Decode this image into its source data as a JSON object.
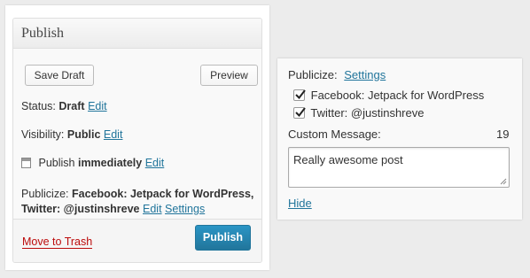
{
  "publish_box": {
    "title": "Publish",
    "save_draft_label": "Save Draft",
    "preview_label": "Preview",
    "status": {
      "label": "Status:",
      "value": "Draft",
      "edit": "Edit"
    },
    "visibility": {
      "label": "Visibility:",
      "value": "Public",
      "edit": "Edit"
    },
    "schedule": {
      "label": "Publish",
      "value": "immediately",
      "edit": "Edit"
    },
    "publicize": {
      "label": "Publicize:",
      "value_line1": "Facebook: Jetpack for WordPress,",
      "value_line2": "Twitter: @justinshreve",
      "edit": "Edit",
      "settings": "Settings"
    },
    "trash_label": "Move to Trash",
    "publish_label": "Publish"
  },
  "publicize_panel": {
    "label": "Publicize:",
    "settings_link": "Settings",
    "services": [
      {
        "label": "Facebook: Jetpack for WordPress",
        "checked": true
      },
      {
        "label": "Twitter: @justinshreve",
        "checked": true
      }
    ],
    "custom_message_label": "Custom Message:",
    "char_count": "19",
    "message_value": "Really awesome post",
    "hide_link": "Hide"
  },
  "colors": {
    "link": "#21759b",
    "trash": "#bc0b0b",
    "primary_button": "#21759b"
  }
}
